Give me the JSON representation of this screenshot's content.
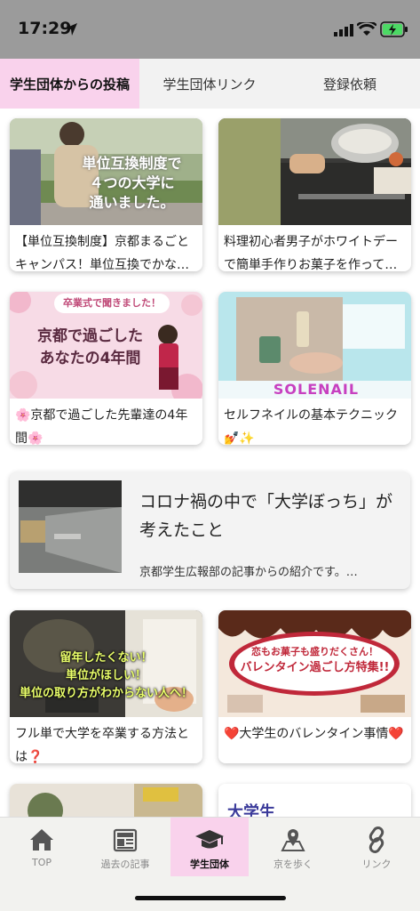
{
  "status": {
    "time": "17:29"
  },
  "tabs": [
    {
      "label": "学生団体からの投稿",
      "active": true
    },
    {
      "label": "学生団体リンク",
      "active": false
    },
    {
      "label": "登録依頼",
      "active": false
    }
  ],
  "cards": [
    {
      "caption": "【単位互換制度】京都まるごとキャンパス！単位互換でかな…",
      "overlay": [
        "単位互換制度で",
        "４つの大学に",
        "通いました。"
      ]
    },
    {
      "caption": "料理初心者男子がホワイトデーで簡単手作りお菓子を作って…"
    },
    {
      "caption": "🌸京都で過ごした先輩達の4年間🌸",
      "overlay": [
        "卒業式で聞きました！",
        "京都で過ごした",
        "あなたの4年間"
      ]
    },
    {
      "caption": "セルフネイルの基本テクニック💅✨",
      "overlay": [
        "SOLENAIL"
      ]
    },
    {
      "caption": "フル単で大学を卒業する方法とは❓",
      "overlay": [
        "留年したくない！",
        "単位がほしい！",
        "単位の取り方がわからない人へ！"
      ]
    },
    {
      "caption": "❤️大学生のバレンタイン事情❤️",
      "overlay": [
        "恋もお菓子も盛りだくさん！",
        "バレンタイン過ごし方特集!!"
      ]
    },
    {
      "caption": "",
      "overlay": [
        "大学生"
      ]
    }
  ],
  "featured": {
    "title": "コロナ禍の中で「大学ぼっち」が考えたこと",
    "subtitle": "京都学生広報部の記事からの紹介です。…"
  },
  "nav": [
    {
      "label": "TOP",
      "icon": "home-icon",
      "active": false
    },
    {
      "label": "過去の記事",
      "icon": "newspaper-icon",
      "active": false
    },
    {
      "label": "学生団体",
      "icon": "graduation-cap-icon",
      "active": true
    },
    {
      "label": "京を歩く",
      "icon": "map-pin-icon",
      "active": false
    },
    {
      "label": "リンク",
      "icon": "link-icon",
      "active": false
    }
  ],
  "colors": {
    "accent_pink": "#f9d2ec",
    "status_bar": "#9b9b9b",
    "nav_bg": "#f2f2ef"
  }
}
